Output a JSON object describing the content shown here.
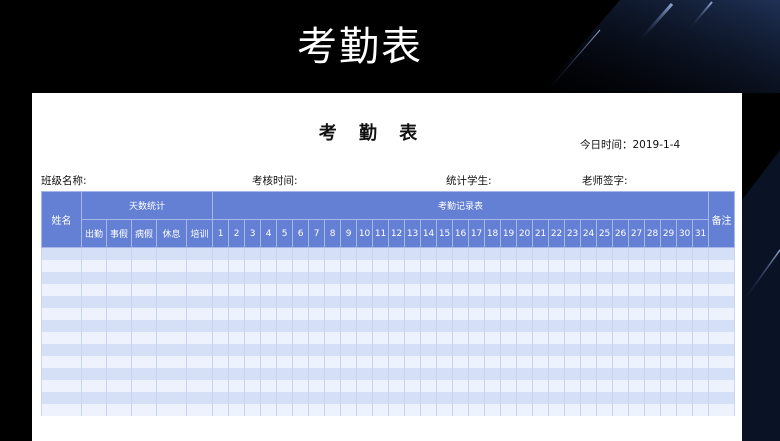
{
  "banner": {
    "title": "考勤表"
  },
  "sheet": {
    "title": "考 勤 表",
    "today": "今日时间：2019-1-4",
    "fields": {
      "class_name": "班级名称:",
      "check_time": "考核时间:",
      "stat_students": "统计学生:",
      "teacher_sign": "老师签字:"
    }
  },
  "table": {
    "name_header": "姓名",
    "stats_group": "天数统计",
    "stats_columns": [
      "出勤",
      "事假",
      "病假",
      "休息",
      "培训"
    ],
    "record_group": "考勤记录表",
    "days": [
      "1",
      "2",
      "3",
      "4",
      "5",
      "6",
      "7",
      "8",
      "9",
      "10",
      "11",
      "12",
      "13",
      "14",
      "15",
      "16",
      "17",
      "18",
      "19",
      "20",
      "21",
      "22",
      "23",
      "24",
      "25",
      "26",
      "27",
      "28",
      "29",
      "30",
      "31"
    ],
    "remark_header": "备注",
    "empty_rows": 14
  },
  "colors": {
    "header_blue": "#6480d4",
    "row_stripe_dark": "#d5e0f6",
    "row_stripe_light": "#edf2fc"
  }
}
